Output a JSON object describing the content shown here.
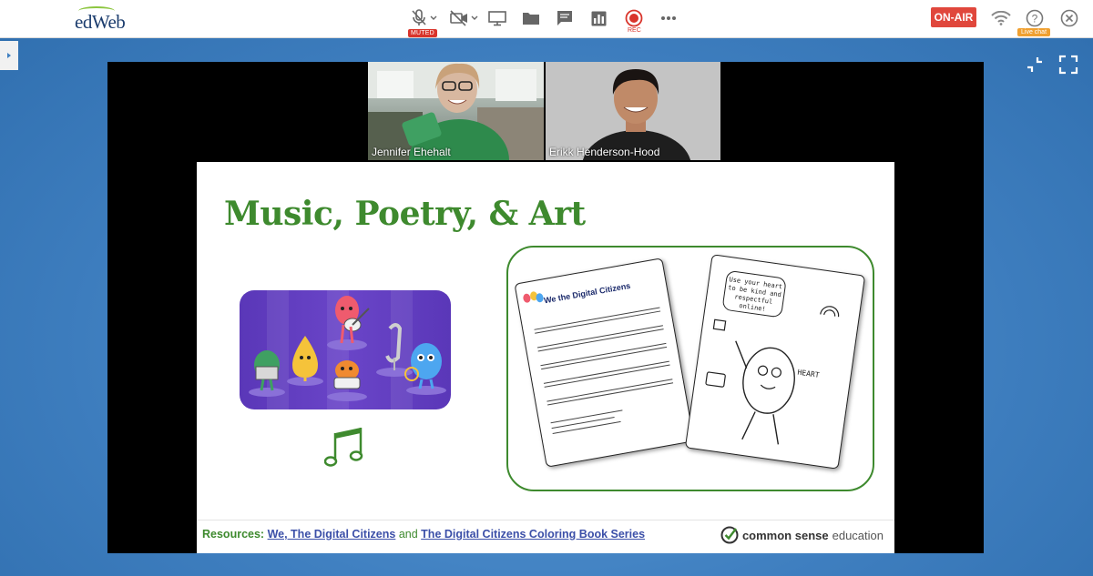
{
  "app": {
    "logo": "edWeb"
  },
  "toolbar": {
    "muted_badge": "MUTED",
    "rec_label": "REC",
    "on_air": "ON-AIR",
    "live_chat": "Live chat",
    "icons": [
      "microphone-muted-icon",
      "camera-off-icon",
      "screen-share-icon",
      "folder-icon",
      "chat-icon",
      "poll-chart-icon",
      "record-icon",
      "more-icon",
      "wifi-icon",
      "help-icon",
      "close-icon"
    ],
    "accent_color": "#e0473c"
  },
  "videos": [
    {
      "name": "Jennifer Ehehalt"
    },
    {
      "name": "Erikk Henderson-Hood"
    }
  ],
  "slide": {
    "title": "Music, Poetry, & Art",
    "sheet1_title": "We the Digital Citizens",
    "bubble_text": "Use your heart to be kind and respectful online!",
    "heart_label": "HEART",
    "footer": {
      "label": "Resources:",
      "link1": "We, The Digital Citizens",
      "and": "and",
      "link2": "The Digital Citizens Coloring Book Series"
    },
    "brand": {
      "strong": "common sense",
      "light": "education"
    },
    "title_color": "#3e8a2e"
  }
}
